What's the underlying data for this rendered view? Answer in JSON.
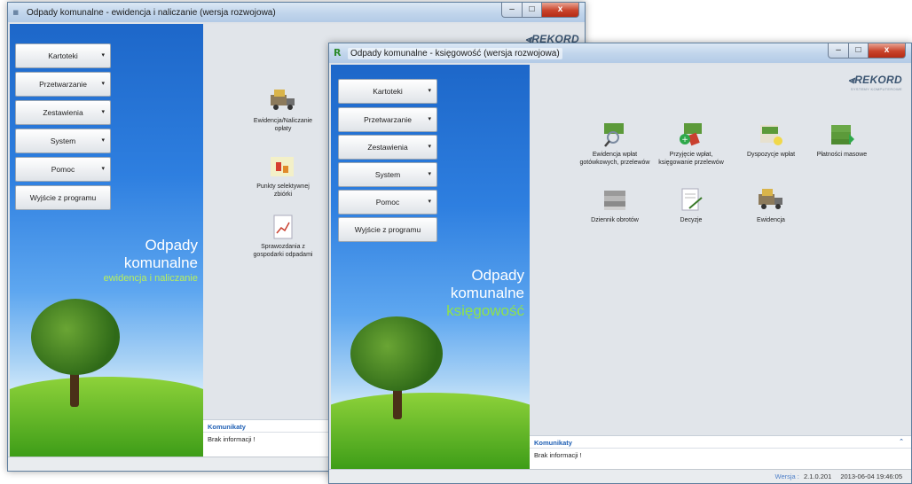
{
  "back_window": {
    "title": "Odpady komunalne - ewidencja i naliczanie (wersja rozwojowa)",
    "controls": {
      "minimize": "–",
      "maximize": "□",
      "close": "x"
    },
    "logo": "REKORD",
    "menu": [
      {
        "label": "Kartoteki",
        "chevron": "▾"
      },
      {
        "label": "Przetwarzanie",
        "chevron": "▾"
      },
      {
        "label": "Zestawienia",
        "chevron": "▾"
      },
      {
        "label": "System",
        "chevron": "▾"
      },
      {
        "label": "Pomoc",
        "chevron": "▾"
      }
    ],
    "exit_label": "Wyjście z programu",
    "brand": {
      "line1": "Odpady",
      "line2": "komunalne",
      "line3": "ewidencja i naliczanie"
    },
    "tiles": [
      {
        "label": "Ewidencja/Naliczanie opłaty",
        "icon": "truck-icon"
      },
      {
        "label": "Punkty selektywnej zbiórki",
        "icon": "collection-point-icon"
      },
      {
        "label": "Sprawozdania z gospodarki odpadami",
        "icon": "report-chart-icon"
      }
    ],
    "messages": {
      "title": "Komunikaty",
      "text": "Brak informacji !"
    }
  },
  "front_window": {
    "title": "Odpady komunalne - księgowość (wersja rozwojowa)",
    "controls": {
      "minimize": "–",
      "maximize": "□",
      "close": "x"
    },
    "logo": "REKORD",
    "logo_sub": "SYSTEMY KOMPUTEROWE",
    "menu": [
      {
        "label": "Kartoteki",
        "chevron": "▾"
      },
      {
        "label": "Przetwarzanie",
        "chevron": "▾"
      },
      {
        "label": "Zestawienia",
        "chevron": "▾"
      },
      {
        "label": "System",
        "chevron": "▾"
      },
      {
        "label": "Pomoc",
        "chevron": "▾"
      }
    ],
    "exit_label": "Wyjście z programu",
    "brand": {
      "line1": "Odpady",
      "line2": "komunalne",
      "line3": "księgowość"
    },
    "tiles": [
      {
        "label": "Ewidencja wpłat gotówkowych, przelewów",
        "icon": "money-search-icon"
      },
      {
        "label": "Przyjęcie wpłat, księgowanie przelewów",
        "icon": "money-add-icon"
      },
      {
        "label": "Dyspozycje wpłat",
        "icon": "money-document-icon"
      },
      {
        "label": "Płatności masowe",
        "icon": "money-stack-icon"
      },
      {
        "label": "Dziennik obrotów",
        "icon": "journal-icon"
      },
      {
        "label": "Decyzje",
        "icon": "document-pen-icon"
      },
      {
        "label": "Ewidencja",
        "icon": "truck-icon"
      }
    ],
    "messages": {
      "title": "Komunikaty",
      "text": "Brak informacji !",
      "collapse": "⌃"
    },
    "status": {
      "version_label": "Wersja :",
      "version": "2.1.0.201",
      "datetime": "2013-06-04 19:46:05"
    }
  }
}
